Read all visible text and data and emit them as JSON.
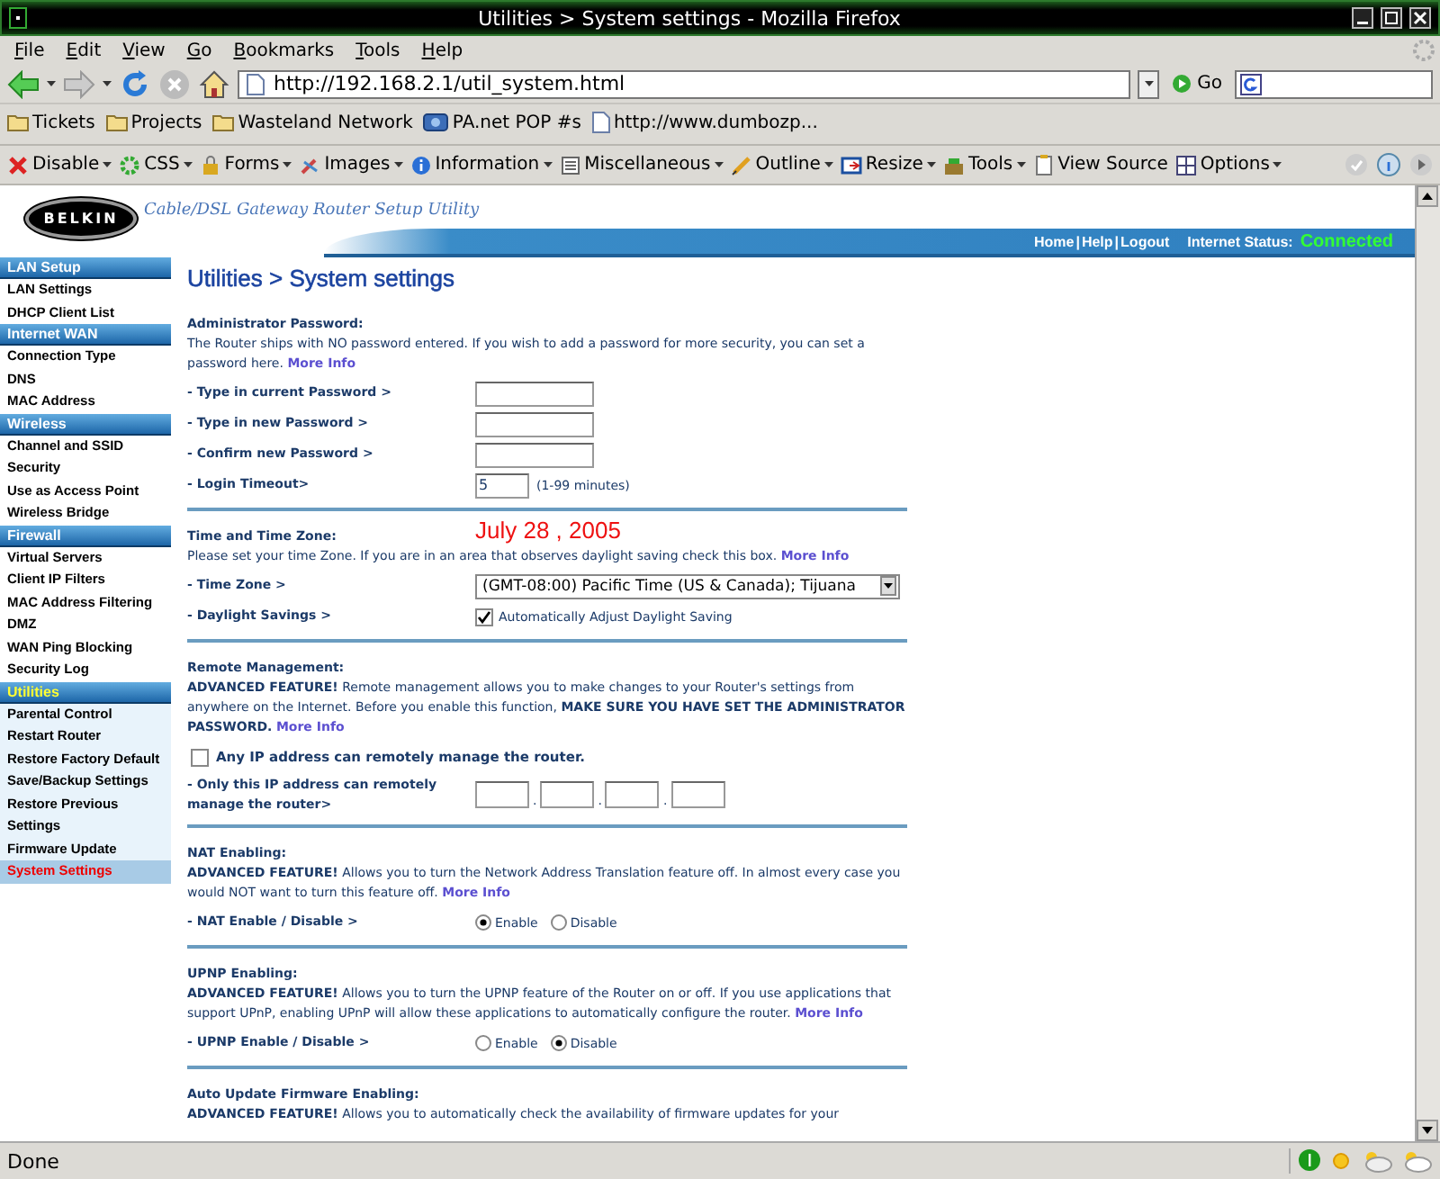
{
  "window": {
    "title": "Utilities > System settings - Mozilla Firefox"
  },
  "menu_bar": [
    "File",
    "Edit",
    "View",
    "Go",
    "Bookmarks",
    "Tools",
    "Help"
  ],
  "nav_toolbar": {
    "url": "http://192.168.2.1/util_system.html",
    "go": "Go"
  },
  "bookmarks": [
    {
      "label": "Tickets",
      "kind": "folder"
    },
    {
      "label": "Projects",
      "kind": "folder"
    },
    {
      "label": "Wasteland Network",
      "kind": "folder"
    },
    {
      "label": "PA.net POP #s",
      "kind": "site"
    },
    {
      "label": "http://www.dumbozp...",
      "kind": "page"
    }
  ],
  "webdev_toolbar": [
    {
      "label": "Disable",
      "kind": "menu"
    },
    {
      "label": "CSS",
      "kind": "menu"
    },
    {
      "label": "Forms",
      "kind": "menu"
    },
    {
      "label": "Images",
      "kind": "menu"
    },
    {
      "label": "Information",
      "kind": "menu"
    },
    {
      "label": "Miscellaneous",
      "kind": "menu"
    },
    {
      "label": "Outline",
      "kind": "menu"
    },
    {
      "label": "Resize",
      "kind": "menu"
    },
    {
      "label": "Tools",
      "kind": "menu"
    },
    {
      "label": "View Source",
      "kind": "button"
    },
    {
      "label": "Options",
      "kind": "menu"
    }
  ],
  "page": {
    "header": {
      "logo": "BELKIN",
      "tagline": "Cable/DSL Gateway Router Setup Utility",
      "links": [
        "Home",
        "Help",
        "Logout"
      ],
      "separators": [
        "|",
        "|"
      ],
      "status_label": "Internet Status:",
      "status_value": "Connected"
    },
    "sidebar": [
      {
        "title": "LAN Setup",
        "selected": false,
        "items": [
          {
            "label": "LAN Settings",
            "selected": false
          },
          {
            "label": "DHCP Client List",
            "selected": false
          }
        ]
      },
      {
        "title": "Internet WAN",
        "selected": false,
        "items": [
          {
            "label": "Connection Type",
            "selected": false
          },
          {
            "label": "DNS",
            "selected": false
          },
          {
            "label": "MAC Address",
            "selected": false
          }
        ]
      },
      {
        "title": "Wireless",
        "selected": false,
        "items": [
          {
            "label": "Channel and SSID",
            "selected": false
          },
          {
            "label": "Security",
            "selected": false
          },
          {
            "label": "Use as Access Point",
            "selected": false
          },
          {
            "label": "Wireless Bridge",
            "selected": false
          }
        ]
      },
      {
        "title": "Firewall",
        "selected": false,
        "items": [
          {
            "label": "Virtual Servers",
            "selected": false
          },
          {
            "label": "Client IP Filters",
            "selected": false
          },
          {
            "label": "MAC Address Filtering",
            "selected": false
          },
          {
            "label": "DMZ",
            "selected": false
          },
          {
            "label": "WAN Ping Blocking",
            "selected": false
          },
          {
            "label": "Security Log",
            "selected": false
          }
        ]
      },
      {
        "title": "Utilities",
        "selected": true,
        "items": [
          {
            "label": "Parental Control",
            "selected": false
          },
          {
            "label": "Restart Router",
            "selected": false
          },
          {
            "label": "Restore Factory Default",
            "selected": false
          },
          {
            "label": "Save/Backup Settings",
            "selected": false
          },
          {
            "label": "Restore Previous Settings",
            "selected": false
          },
          {
            "label": "Firmware Update",
            "selected": false
          },
          {
            "label": "System Settings",
            "selected": true
          }
        ]
      }
    ],
    "heading": "Utilities > System settings",
    "sections": [
      {
        "title": "Administrator Password:",
        "text": "The Router ships with NO password entered. If you wish to add a password for more security, you can set a password here.",
        "link": "More Info",
        "rows": [
          {
            "kind": "password",
            "label": "- Type in current Password >"
          },
          {
            "kind": "password",
            "label": "- Type in new Password >"
          },
          {
            "kind": "password",
            "label": "- Confirm new Password >"
          },
          {
            "kind": "text",
            "label": "- Login Timeout>",
            "value": "5",
            "hint": "(1-99 minutes)"
          }
        ]
      },
      {
        "title": "Time and Time Zone:",
        "date": "July 28 , 2005",
        "text": "Please set your time Zone. If you are in an area that observes daylight saving check this box.",
        "link": "More Info",
        "rows": [
          {
            "kind": "select",
            "label": "- Time Zone >",
            "value": "(GMT-08:00) Pacific Time (US & Canada); Tijuana"
          },
          {
            "kind": "checkbox",
            "label": "- Daylight Savings >",
            "option": "Automatically Adjust Daylight Saving",
            "checked": true
          }
        ]
      },
      {
        "title": "Remote Management:",
        "text": "**ADVANCED FEATURE!** Remote management allows you to make changes to your Router's settings from anywhere on the Internet. Before you enable this function, **MAKE SURE YOU HAVE SET THE ADMINISTRATOR PASSWORD.**",
        "link": "More Info",
        "rows": [
          {
            "kind": "wide_checkbox",
            "option": "Any IP address can remotely manage the router.",
            "checked": false
          },
          {
            "kind": "ip",
            "label": "- Only this IP address can remotely manage the router>",
            "separators": [
              ".",
              ".",
              "."
            ]
          }
        ]
      },
      {
        "title": "NAT Enabling:",
        "text": "**ADVANCED FEATURE!** Allows you to turn the Network Address Translation feature off. In almost every case you would NOT want to turn this feature off.",
        "link": "More Info",
        "rows": [
          {
            "kind": "radio",
            "label": "- NAT Enable / Disable >",
            "options": [
              {
                "label": "Enable",
                "selected": true
              },
              {
                "label": "Disable",
                "selected": false
              }
            ]
          }
        ]
      },
      {
        "title": "UPNP Enabling:",
        "text": "**ADVANCED FEATURE!** Allows you to turn the UPNP feature of the Router on or off. If you use applications that support UPnP, enabling UPnP will allow these applications to automatically configure the router.",
        "link": "More Info",
        "rows": [
          {
            "kind": "radio",
            "label": "- UPNP Enable / Disable >",
            "options": [
              {
                "label": "Enable",
                "selected": false
              },
              {
                "label": "Disable",
                "selected": true
              }
            ]
          }
        ]
      },
      {
        "title": "Auto Update Firmware Enabling:",
        "text": "**ADVANCED FEATURE!** Allows you to automatically check the availability of firmware updates for your"
      }
    ]
  },
  "status_bar": {
    "text": "Done"
  }
}
